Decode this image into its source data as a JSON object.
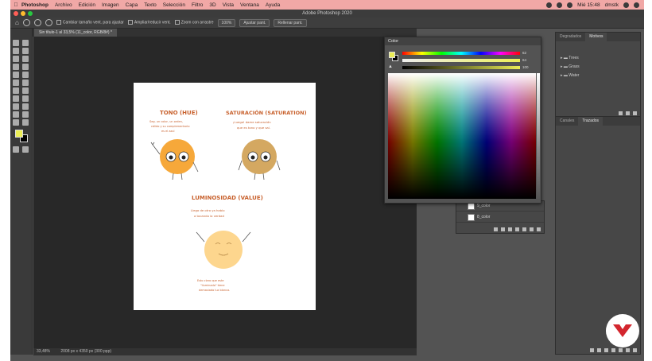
{
  "menubar": {
    "items": [
      "Photoshop",
      "Archivo",
      "Edición",
      "Imagen",
      "Capa",
      "Texto",
      "Selección",
      "Filtro",
      "3D",
      "Vista",
      "Ventana",
      "Ayuda"
    ],
    "clock": "Mié 15:48",
    "user": "dmstk"
  },
  "window": {
    "title": "Adobe Photoshop 2020"
  },
  "options": {
    "resize": "Cambiar tamaño vent. para ajustar",
    "expand": "Ampliar/reducir vent.",
    "scrubby": "Zoom con arrastre",
    "zoom_pct": "100%",
    "fit": "Ajustar pant.",
    "fill": "Rellenar pant."
  },
  "document": {
    "tab": "Sin título-1 al 33,5% (11_color, RGB/8#) *"
  },
  "status": {
    "zoom": "33,48%",
    "size": "2008 px x 4350 px (300 ppp)"
  },
  "color_panel": {
    "title": "Color",
    "values": [
      "62",
      "64",
      "100"
    ],
    "fg_color": "#ecef56",
    "bg_color": "#000000"
  },
  "layers": [
    {
      "name": "9_color"
    },
    {
      "name": "8_color"
    }
  ],
  "motivos_panel": {
    "tabs": [
      "Degradados",
      "Motivos"
    ],
    "active": "Motivos",
    "folders": [
      "Trees",
      "Grass",
      "Water"
    ]
  },
  "trazados_panel": {
    "tabs": [
      "Canales",
      "Trazados"
    ],
    "active": "Trazados"
  },
  "artwork": {
    "hue_title": "TONO (HUE)",
    "hue_text_1": "Seg. un color, un orden,",
    "hue_text_2": "cálido y su complementario",
    "hue_text_3": "es el azul",
    "sat_title": "SATURACIÓN (SATURATION)",
    "sat_text_1": "¡Luego! dame saturación",
    "sat_text_2": "que es tono y que sal.",
    "lum_title": "LUMINOSIDAD (VALUE)",
    "lum_text_1": "Llega de otro ya hablo",
    "lum_text_2": "a tocando la verdad",
    "lum_text_3": "Esto claro que este",
    "lum_text_4": "\"iluminado\" tiene",
    "lum_text_5": "demasiado luz blanca."
  }
}
